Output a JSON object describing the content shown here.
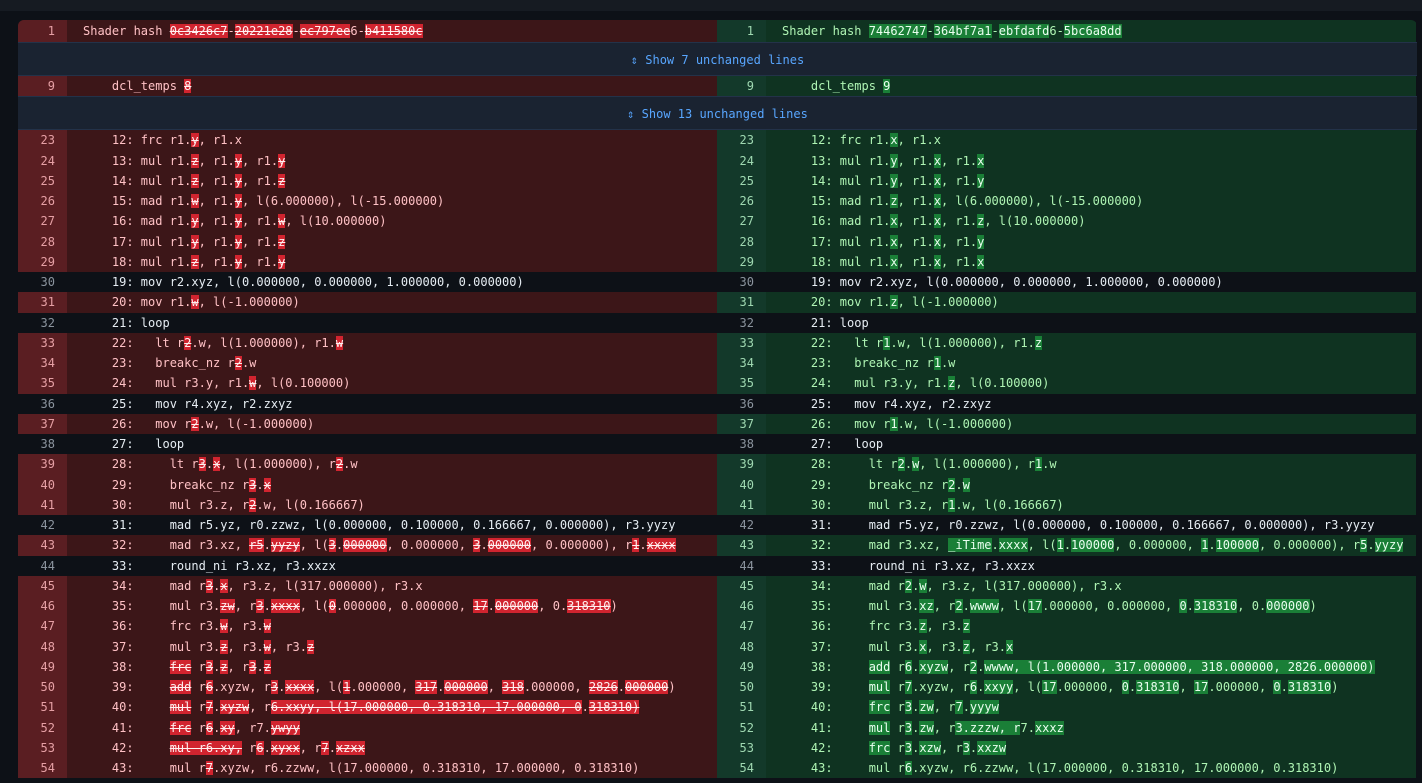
{
  "header": {
    "left_hash_prefix": "Shader hash ",
    "left_hash": "0c3426c7-20221e28-ec797ee6-b411580c",
    "right_hash_prefix": "Shader hash ",
    "right_hash": "74462747-364bf7a1-ebfdafd6-5bc6a8dd"
  },
  "expanders": [
    {
      "icon": "⇕",
      "label": "Show 7 unchanged lines"
    },
    {
      "icon": "⇕",
      "label": "Show 13 unchanged lines"
    }
  ],
  "dcl": {
    "left_num": "9",
    "right_num": "9",
    "left": "dcl_temps 8",
    "right": "dcl_temps 9"
  },
  "rows": [
    {
      "type": "chg",
      "ln": "23",
      "rn": "23",
      "left": "12: frc r1.y, r1.x",
      "right": "12: frc r1.x, r1.x"
    },
    {
      "type": "chg",
      "ln": "24",
      "rn": "24",
      "left": "13: mul r1.z, r1.y, r1.y",
      "right": "13: mul r1.y, r1.x, r1.x"
    },
    {
      "type": "chg",
      "ln": "25",
      "rn": "25",
      "left": "14: mul r1.z, r1.y, r1.z",
      "right": "14: mul r1.y, r1.x, r1.y"
    },
    {
      "type": "chg",
      "ln": "26",
      "rn": "26",
      "left": "15: mad r1.w, r1.y, l(6.000000), l(-15.000000)",
      "right": "15: mad r1.z, r1.x, l(6.000000), l(-15.000000)"
    },
    {
      "type": "chg",
      "ln": "27",
      "rn": "27",
      "left": "16: mad r1.y, r1.y, r1.w, l(10.000000)",
      "right": "16: mad r1.x, r1.x, r1.z, l(10.000000)"
    },
    {
      "type": "chg",
      "ln": "28",
      "rn": "28",
      "left": "17: mul r1.y, r1.y, r1.z",
      "right": "17: mul r1.x, r1.x, r1.y"
    },
    {
      "type": "chg",
      "ln": "29",
      "rn": "29",
      "left": "18: mul r1.z, r1.y, r1.y",
      "right": "18: mul r1.x, r1.x, r1.x"
    },
    {
      "type": "same",
      "ln": "30",
      "rn": "30",
      "left": "19: mov r2.xyz, l(0.000000, 0.000000, 1.000000, 0.000000)",
      "right": "19: mov r2.xyz, l(0.000000, 0.000000, 1.000000, 0.000000)"
    },
    {
      "type": "chg",
      "ln": "31",
      "rn": "31",
      "left": "20: mov r1.w, l(-1.000000)",
      "right": "20: mov r1.z, l(-1.000000)"
    },
    {
      "type": "same",
      "ln": "32",
      "rn": "32",
      "left": "21: loop",
      "right": "21: loop"
    },
    {
      "type": "chg",
      "ln": "33",
      "rn": "33",
      "left": "22:   lt r2.w, l(1.000000), r1.w",
      "right": "22:   lt r1.w, l(1.000000), r1.z"
    },
    {
      "type": "chg",
      "ln": "34",
      "rn": "34",
      "left": "23:   breakc_nz r2.w",
      "right": "23:   breakc_nz r1.w"
    },
    {
      "type": "chg",
      "ln": "35",
      "rn": "35",
      "left": "24:   mul r3.y, r1.w, l(0.100000)",
      "right": "24:   mul r3.y, r1.z, l(0.100000)"
    },
    {
      "type": "same",
      "ln": "36",
      "rn": "36",
      "left": "25:   mov r4.xyz, r2.zxyz",
      "right": "25:   mov r4.xyz, r2.zxyz"
    },
    {
      "type": "chg",
      "ln": "37",
      "rn": "37",
      "left": "26:   mov r2.w, l(-1.000000)",
      "right": "26:   mov r1.w, l(-1.000000)"
    },
    {
      "type": "same",
      "ln": "38",
      "rn": "38",
      "left": "27:   loop",
      "right": "27:   loop"
    },
    {
      "type": "chg",
      "ln": "39",
      "rn": "39",
      "left": "28:     lt r3.x, l(1.000000), r2.w",
      "right": "28:     lt r2.w, l(1.000000), r1.w"
    },
    {
      "type": "chg",
      "ln": "40",
      "rn": "40",
      "left": "29:     breakc_nz r3.x",
      "right": "29:     breakc_nz r2.w"
    },
    {
      "type": "chg",
      "ln": "41",
      "rn": "41",
      "left": "30:     mul r3.z, r2.w, l(0.166667)",
      "right": "30:     mul r3.z, r1.w, l(0.166667)"
    },
    {
      "type": "same",
      "ln": "42",
      "rn": "42",
      "left": "31:     mad r5.yz, r0.zzwz, l(0.000000, 0.100000, 0.166667, 0.000000), r3.yyzy",
      "right": "31:     mad r5.yz, r0.zzwz, l(0.000000, 0.100000, 0.166667, 0.000000), r3.yyzy"
    },
    {
      "type": "chg",
      "ln": "43",
      "rn": "43",
      "left": "32:     mad r3.xz, r5.yyzy, l(3.000000, 0.000000, 3.000000, 0.000000), r1.xxxx",
      "right": "32:     mad r3.xz, _iTime.xxxx, l(1.100000, 0.000000, 1.100000, 0.000000), r5.yyzy"
    },
    {
      "type": "same",
      "ln": "44",
      "rn": "44",
      "left": "33:     round_ni r3.xz, r3.xxzx",
      "right": "33:     round_ni r3.xz, r3.xxzx"
    },
    {
      "type": "chg",
      "ln": "45",
      "rn": "45",
      "left": "34:     mad r3.x, r3.z, l(317.000000), r3.x",
      "right": "34:     mad r2.w, r3.z, l(317.000000), r3.x"
    },
    {
      "type": "chg",
      "ln": "46",
      "rn": "46",
      "left": "35:     mul r3.zw, r3.xxxx, l(0.000000, 0.000000, 17.000000, 0.318310)",
      "right": "35:     mul r3.xz, r2.wwww, l(17.000000, 0.000000, 0.318310, 0.000000)"
    },
    {
      "type": "chg",
      "ln": "47",
      "rn": "47",
      "left": "36:     frc r3.w, r3.w",
      "right": "36:     frc r3.z, r3.z"
    },
    {
      "type": "chg",
      "ln": "48",
      "rn": "48",
      "left": "37:     mul r3.z, r3.w, r3.z",
      "right": "37:     mul r3.x, r3.z, r3.x"
    },
    {
      "type": "chg",
      "ln": "49",
      "rn": "49",
      "left": "38:     frc r3.z, r3.z",
      "right": "38:     add r6.xyzw, r2.wwww, l(1.000000, 317.000000, 318.000000, 2826.000000)"
    },
    {
      "type": "chg",
      "ln": "50",
      "rn": "50",
      "left": "39:     add r6.xyzw, r3.xxxx, l(1.000000, 317.000000, 318.000000, 2826.000000)",
      "right": "39:     mul r7.xyzw, r6.xxyy, l(17.000000, 0.318310, 17.000000, 0.318310)"
    },
    {
      "type": "chg",
      "ln": "51",
      "rn": "51",
      "left": "40:     mul r7.xyzw, r6.xxyy, l(17.000000, 0.318310, 17.000000, 0.318310)",
      "right": "40:     frc r3.zw, r7.yyyw"
    },
    {
      "type": "chg",
      "ln": "52",
      "rn": "52",
      "left": "41:     frc r6.xy, r7.ywyy",
      "right": "41:     mul r3.zw, r3.zzzw, r7.xxxz"
    },
    {
      "type": "chg",
      "ln": "53",
      "rn": "53",
      "left": "42:     mul r6.xy, r6.xyxx, r7.xzxx",
      "right": "42:     frc r3.xzw, r3.xxzw"
    },
    {
      "type": "chg",
      "ln": "54",
      "rn": "54",
      "left": "43:     mul r7.xyzw, r6.zzww, l(17.000000, 0.318310, 17.000000, 0.318310)",
      "right": "43:     mul r6.xyzw, r6.zzww, l(17.000000, 0.318310, 17.000000, 0.318310)"
    }
  ]
}
